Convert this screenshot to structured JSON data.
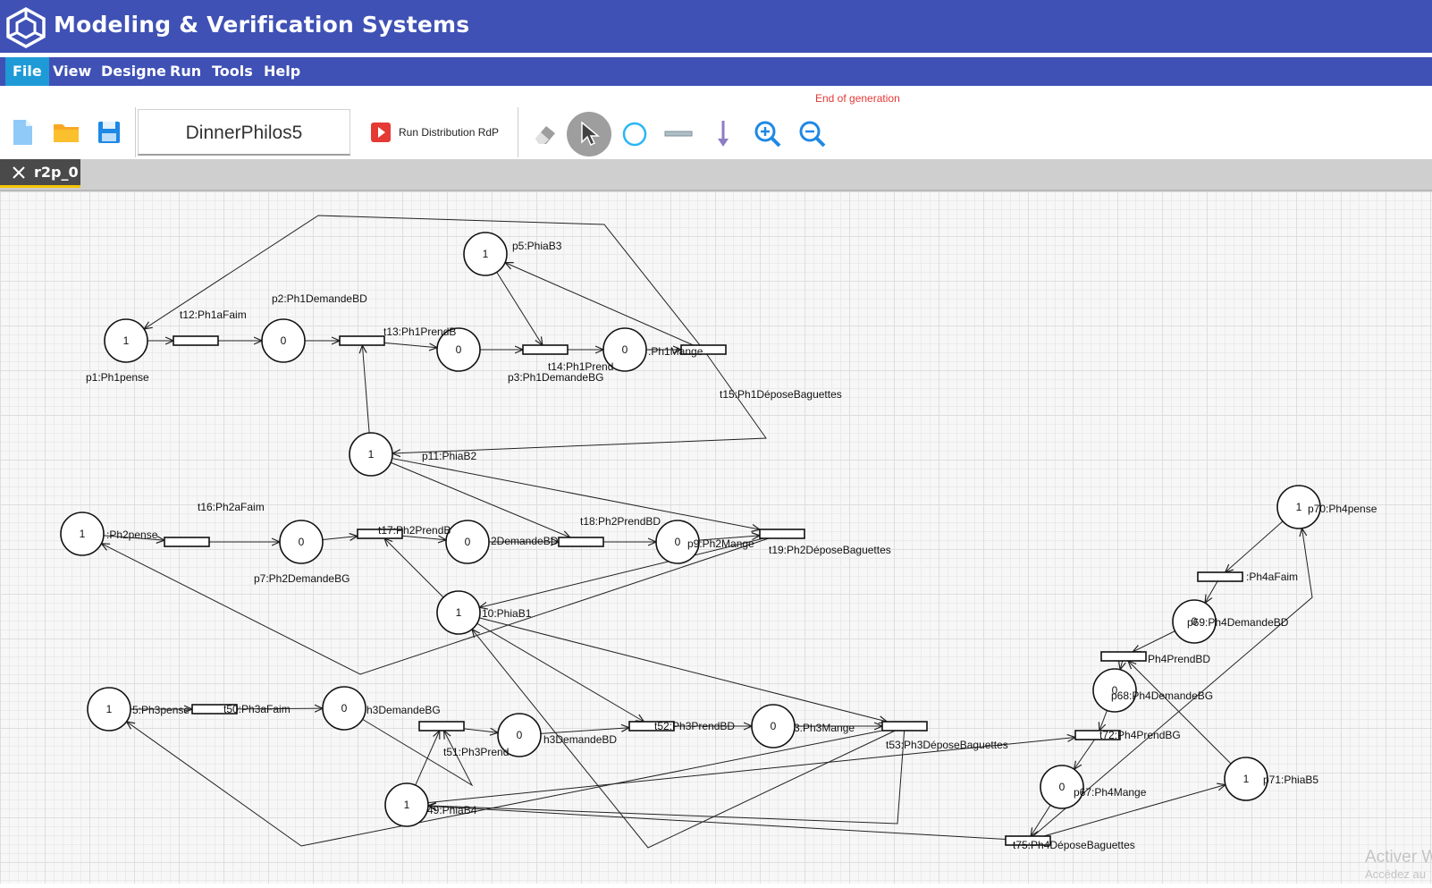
{
  "app": {
    "title": "Modeling & Verification Systems",
    "logo_icon": "cube-logo-icon"
  },
  "menu": {
    "items": [
      "File",
      "View",
      "Designe",
      "Run",
      "Tools",
      "Help"
    ],
    "active": "File"
  },
  "toolbar": {
    "status_message": "End of generation",
    "file_name": "DinnerPhilos5",
    "run_label": "Run Distribution RdP",
    "status_color": "#e53935"
  },
  "tabs": [
    {
      "label": "r2p_0"
    }
  ],
  "net": {
    "places": [
      {
        "id": "p1",
        "label": "p1:Ph1pense",
        "tokens": "1"
      },
      {
        "id": "p2",
        "label": "p2:Ph1DemandeBD",
        "tokens": "0"
      },
      {
        "id": "p3",
        "label": "p3:Ph1DemandeBG",
        "tokens": "0"
      },
      {
        "id": "p4",
        "label": ":Ph1Mange",
        "tokens": "0"
      },
      {
        "id": "p5",
        "label": "p5:PhiaB3",
        "tokens": "1"
      },
      {
        "id": "p11",
        "label": "p11:PhiaB2",
        "tokens": "1"
      },
      {
        "id": "p6",
        "label": ":Ph2pense",
        "tokens": "1"
      },
      {
        "id": "p7",
        "label": "p7:Ph2DemandeBG",
        "tokens": "0"
      },
      {
        "id": "p8",
        "label": "2DemandeBD",
        "tokens": "0"
      },
      {
        "id": "p9",
        "label": "p9:Ph2Mange",
        "tokens": "0"
      },
      {
        "id": "p10",
        "label": "10:PhiaB1",
        "tokens": "1"
      },
      {
        "id": "p45",
        "label": "5:Ph3pense",
        "tokens": "1"
      },
      {
        "id": "p46",
        "label": "h3DemandeBG",
        "tokens": "0"
      },
      {
        "id": "p47",
        "label": "h3DemandeBD",
        "tokens": "0"
      },
      {
        "id": "p48",
        "label": "3:Ph3Mange",
        "tokens": "0"
      },
      {
        "id": "p49",
        "label": "49:PhiaB4",
        "tokens": "1"
      },
      {
        "id": "p70",
        "label": "p70:Ph4pense",
        "tokens": "1"
      },
      {
        "id": "p69",
        "label": "p69:Ph4DemandeBD",
        "tokens": "0"
      },
      {
        "id": "p68",
        "label": "p68:Ph4DemandeBG",
        "tokens": "0"
      },
      {
        "id": "p67",
        "label": "p67:Ph4Mange",
        "tokens": "0"
      },
      {
        "id": "p71",
        "label": "p71:PhiaB5",
        "tokens": "1"
      }
    ],
    "transitions": [
      {
        "id": "t12",
        "label": "t12:Ph1aFaim"
      },
      {
        "id": "t13",
        "label": "t13:Ph1PrendB"
      },
      {
        "id": "t14",
        "label": "t14:Ph1Prend"
      },
      {
        "id": "t15",
        "label": "t15:Ph1DéposeBaguettes"
      },
      {
        "id": "t16",
        "label": "t16:Ph2aFaim"
      },
      {
        "id": "t17",
        "label": "t17:Ph2PrendB"
      },
      {
        "id": "t18",
        "label": "t18:Ph2PrendBD"
      },
      {
        "id": "t19",
        "label": "t19:Ph2DéposeBaguettes"
      },
      {
        "id": "t50",
        "label": "t50:Ph3aFaim"
      },
      {
        "id": "t51",
        "label": "t51:Ph3Prend"
      },
      {
        "id": "t52",
        "label": "t52:Ph3PrendBD"
      },
      {
        "id": "t53",
        "label": "t53:Ph3DéposeBaguettes"
      },
      {
        "id": "t72",
        "label": ":Ph4aFaim"
      },
      {
        "id": "t73",
        "label": "Ph4PrendBD"
      },
      {
        "id": "t74",
        "label": "t72:Ph4PrendBG"
      },
      {
        "id": "t75",
        "label": "t75:Ph4DéposeBaguettes"
      }
    ]
  },
  "watermark": {
    "line1": "Activer W",
    "line2": "Accédez au"
  }
}
